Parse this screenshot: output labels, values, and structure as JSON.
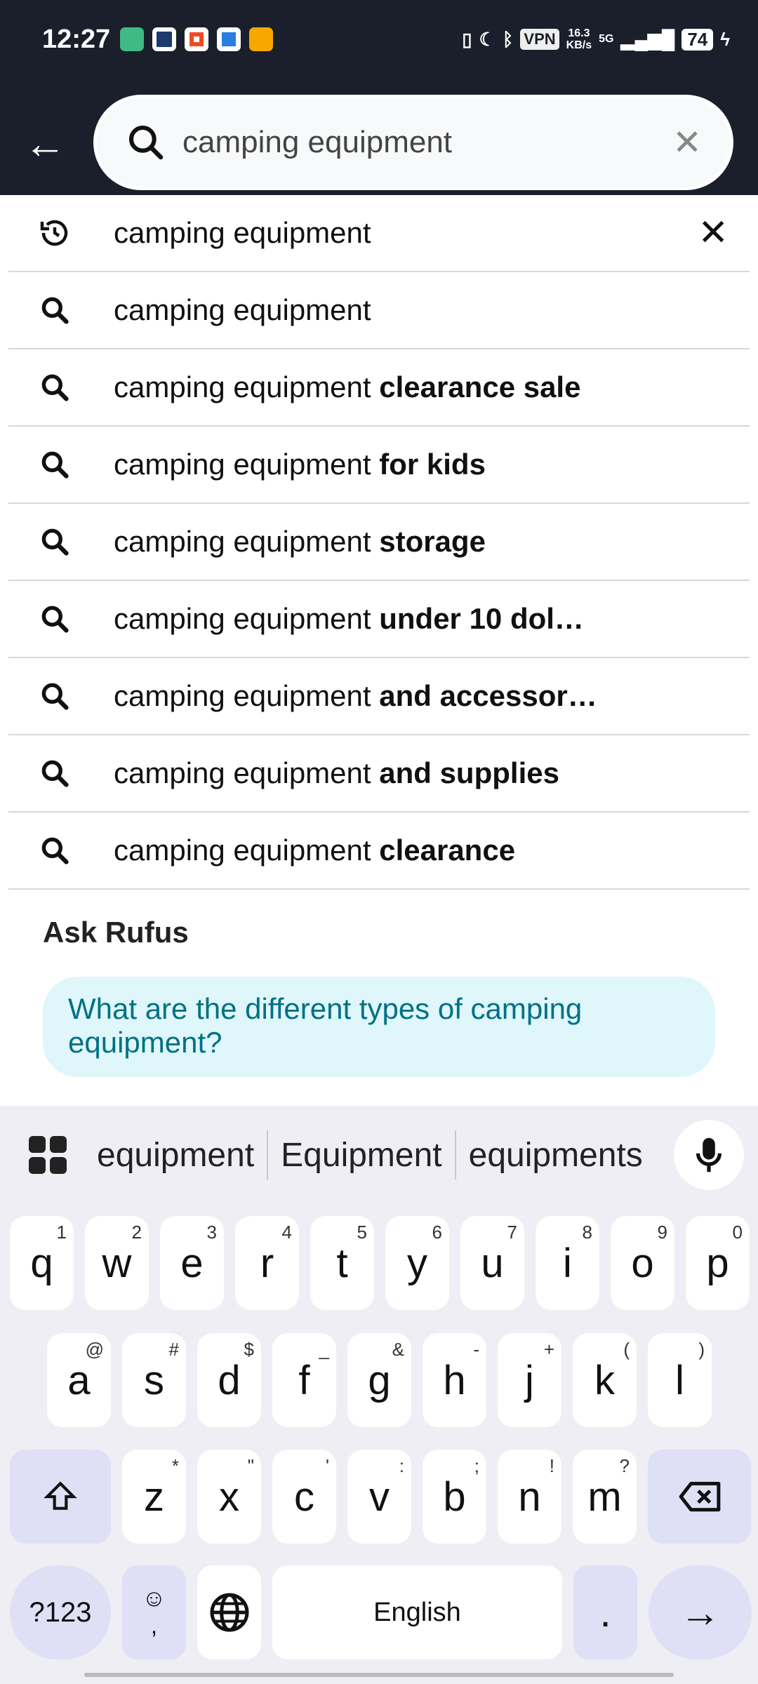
{
  "status_bar": {
    "time": "12:27",
    "vpn": "VPN",
    "speed": "16.3",
    "speed_unit": "KB/s",
    "network": "5G",
    "battery": "74",
    "app_icon_colors": [
      "#3fba85",
      "#1d3a6e",
      "#f04a24",
      "#2a7de1",
      "#f6a800"
    ]
  },
  "search": {
    "query": "camping equipment",
    "back_icon": "arrow-left-icon",
    "clear_icon": "close-icon"
  },
  "suggestions": [
    {
      "base": "camping equipment",
      "suffix": "",
      "icon": "history-icon",
      "removable": true
    },
    {
      "base": "camping equipment",
      "suffix": "",
      "icon": "search-icon"
    },
    {
      "base": "camping equipment",
      "suffix": " clearance sale",
      "icon": "search-icon"
    },
    {
      "base": "camping equipment",
      "suffix": " for kids",
      "icon": "search-icon"
    },
    {
      "base": "camping equipment",
      "suffix": " storage",
      "icon": "search-icon"
    },
    {
      "base": "camping equipment",
      "suffix": " under 10 dol…",
      "icon": "search-icon"
    },
    {
      "base": "camping equipment",
      "suffix": " and accessor…",
      "icon": "search-icon"
    },
    {
      "base": "camping equipment",
      "suffix": " and supplies",
      "icon": "search-icon"
    },
    {
      "base": "camping equipment",
      "suffix": " clearance",
      "icon": "search-icon"
    }
  ],
  "rufus": {
    "heading": "Ask Rufus",
    "question": "What are the different types of camping equipment?"
  },
  "keyboard": {
    "suggestions": [
      "equipment",
      "Equipment",
      "equipments"
    ],
    "row1": [
      [
        "q",
        "1"
      ],
      [
        "w",
        "2"
      ],
      [
        "e",
        "3"
      ],
      [
        "r",
        "4"
      ],
      [
        "t",
        "5"
      ],
      [
        "y",
        "6"
      ],
      [
        "u",
        "7"
      ],
      [
        "i",
        "8"
      ],
      [
        "o",
        "9"
      ],
      [
        "p",
        "0"
      ]
    ],
    "row2": [
      [
        "a",
        "@"
      ],
      [
        "s",
        "#"
      ],
      [
        "d",
        "$"
      ],
      [
        "f",
        "_"
      ],
      [
        "g",
        "&"
      ],
      [
        "h",
        "-"
      ],
      [
        "j",
        "+"
      ],
      [
        "k",
        "("
      ],
      [
        "l",
        ")"
      ]
    ],
    "row3": [
      [
        "z",
        "*"
      ],
      [
        "x",
        "\""
      ],
      [
        "c",
        "'"
      ],
      [
        "v",
        ":"
      ],
      [
        "b",
        ";"
      ],
      [
        "n",
        "!"
      ],
      [
        "m",
        "?"
      ]
    ],
    "symbols": "?123",
    "comma": ",",
    "space": "English",
    "period": "."
  }
}
